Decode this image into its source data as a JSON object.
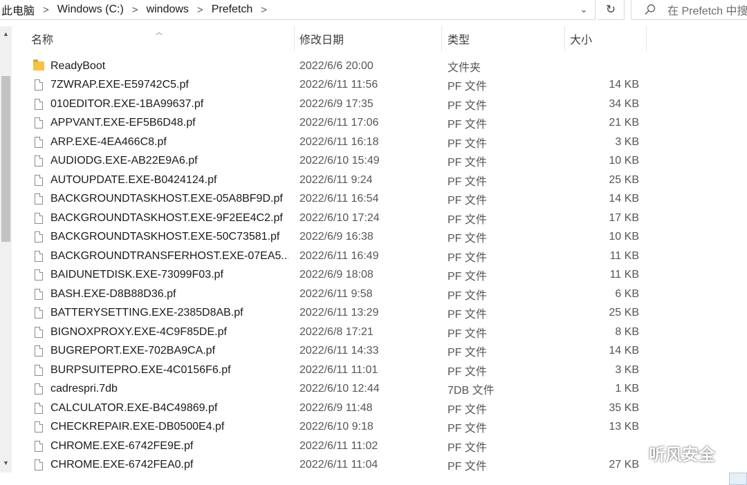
{
  "address_bar": {
    "crumbs": [
      "此电脑",
      "Windows (C:)",
      "windows",
      "Prefetch"
    ],
    "separator": ">",
    "dropdown_glyph": "⌄",
    "refresh_glyph": "↻"
  },
  "search": {
    "placeholder": "在 Prefetch 中搜"
  },
  "columns": {
    "name": "名称",
    "date": "修改日期",
    "type": "类型",
    "size": "大小"
  },
  "files": [
    {
      "icon": "folder-icon",
      "name": "ReadyBoot",
      "date": "2022/6/6 20:00",
      "type": "文件夹",
      "size": ""
    },
    {
      "icon": "file-icon",
      "name": "7ZWRAP.EXE-E59742C5.pf",
      "date": "2022/6/11 11:56",
      "type": "PF 文件",
      "size": "14 KB"
    },
    {
      "icon": "file-icon",
      "name": "010EDITOR.EXE-1BA99637.pf",
      "date": "2022/6/9 17:35",
      "type": "PF 文件",
      "size": "34 KB"
    },
    {
      "icon": "file-icon",
      "name": "APPVANT.EXE-EF5B6D48.pf",
      "date": "2022/6/11 17:06",
      "type": "PF 文件",
      "size": "21 KB"
    },
    {
      "icon": "file-icon",
      "name": "ARP.EXE-4EA466C8.pf",
      "date": "2022/6/11 16:18",
      "type": "PF 文件",
      "size": "3 KB"
    },
    {
      "icon": "file-icon",
      "name": "AUDIODG.EXE-AB22E9A6.pf",
      "date": "2022/6/10 15:49",
      "type": "PF 文件",
      "size": "10 KB"
    },
    {
      "icon": "file-icon",
      "name": "AUTOUPDATE.EXE-B0424124.pf",
      "date": "2022/6/11 9:24",
      "type": "PF 文件",
      "size": "25 KB"
    },
    {
      "icon": "file-icon",
      "name": "BACKGROUNDTASKHOST.EXE-05A8BF9D.pf",
      "date": "2022/6/11 16:54",
      "type": "PF 文件",
      "size": "14 KB"
    },
    {
      "icon": "file-icon",
      "name": "BACKGROUNDTASKHOST.EXE-9F2EE4C2.pf",
      "date": "2022/6/10 17:24",
      "type": "PF 文件",
      "size": "17 KB"
    },
    {
      "icon": "file-icon",
      "name": "BACKGROUNDTASKHOST.EXE-50C73581.pf",
      "date": "2022/6/9 16:38",
      "type": "PF 文件",
      "size": "10 KB"
    },
    {
      "icon": "file-icon",
      "name": "BACKGROUNDTRANSFERHOST.EXE-07EA5...",
      "date": "2022/6/11 16:49",
      "type": "PF 文件",
      "size": "11 KB"
    },
    {
      "icon": "file-icon",
      "name": "BAIDUNETDISK.EXE-73099F03.pf",
      "date": "2022/6/9 18:08",
      "type": "PF 文件",
      "size": "11 KB"
    },
    {
      "icon": "file-icon",
      "name": "BASH.EXE-D8B88D36.pf",
      "date": "2022/6/11 9:58",
      "type": "PF 文件",
      "size": "6 KB"
    },
    {
      "icon": "file-icon",
      "name": "BATTERYSETTING.EXE-2385D8AB.pf",
      "date": "2022/6/11 13:29",
      "type": "PF 文件",
      "size": "25 KB"
    },
    {
      "icon": "file-icon",
      "name": "BIGNOXPROXY.EXE-4C9F85DE.pf",
      "date": "2022/6/8 17:21",
      "type": "PF 文件",
      "size": "8 KB"
    },
    {
      "icon": "file-icon",
      "name": "BUGREPORT.EXE-702BA9CA.pf",
      "date": "2022/6/11 14:33",
      "type": "PF 文件",
      "size": "14 KB"
    },
    {
      "icon": "file-icon",
      "name": "BURPSUITEPRO.EXE-4C0156F6.pf",
      "date": "2022/6/11 11:01",
      "type": "PF 文件",
      "size": "3 KB"
    },
    {
      "icon": "file-icon",
      "name": "cadrespri.7db",
      "date": "2022/6/10 12:44",
      "type": "7DB 文件",
      "size": "1 KB"
    },
    {
      "icon": "file-icon",
      "name": "CALCULATOR.EXE-B4C49869.pf",
      "date": "2022/6/9 11:48",
      "type": "PF 文件",
      "size": "35 KB"
    },
    {
      "icon": "file-icon",
      "name": "CHECKREPAIR.EXE-DB0500E4.pf",
      "date": "2022/6/10 9:18",
      "type": "PF 文件",
      "size": "13 KB"
    },
    {
      "icon": "file-icon",
      "name": "CHROME.EXE-6742FE9E.pf",
      "date": "2022/6/11 11:02",
      "type": "PF 文件",
      "size": ""
    },
    {
      "icon": "file-icon",
      "name": "CHROME.EXE-6742FEA0.pf",
      "date": "2022/6/11 11:04",
      "type": "PF 文件",
      "size": "27 KB"
    }
  ],
  "watermark": {
    "text": "听风安全"
  }
}
